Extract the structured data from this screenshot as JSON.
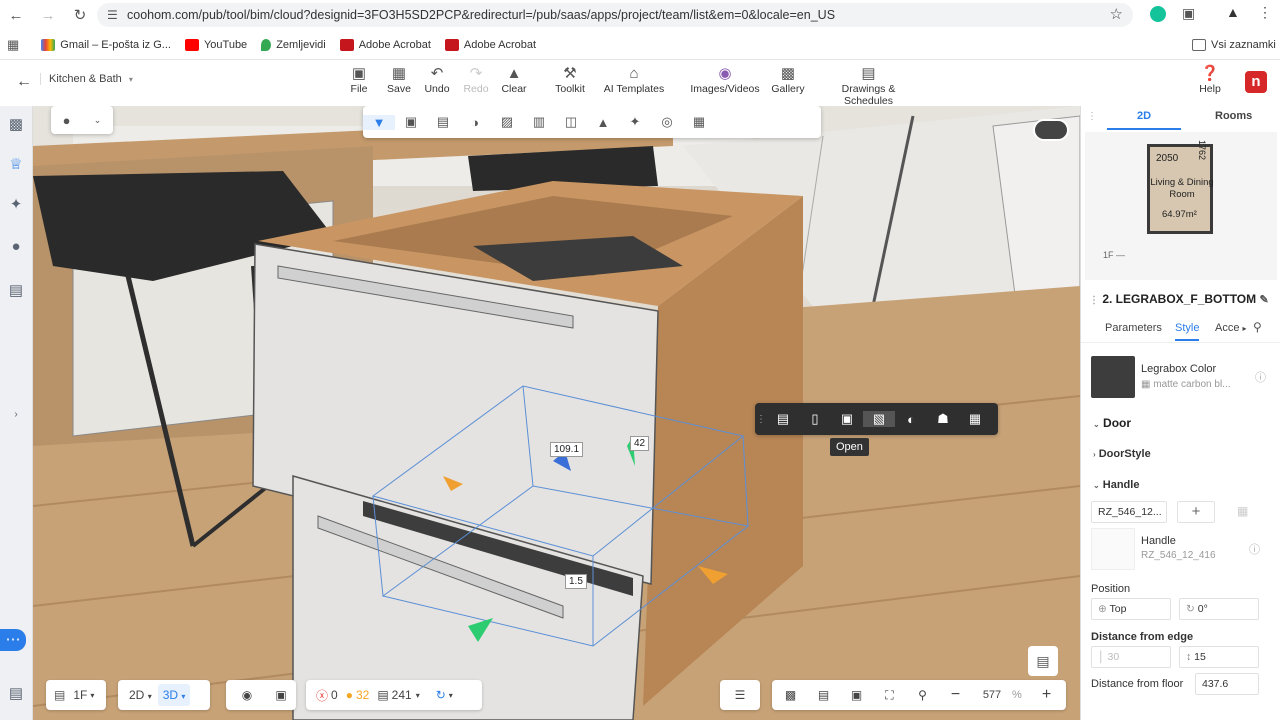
{
  "browser": {
    "url": "coohom.com/pub/tool/bim/cloud?designid=3FO3H5SD2PCP&redirecturl=/pub/saas/apps/project/team/list&em=0&locale=en_US",
    "bookmarks": [
      "Gmail – E-pošta iz G...",
      "YouTube",
      "Zemljevidi",
      "Adobe Acrobat",
      "Adobe Acrobat"
    ],
    "all_bookmarks": "Vsi zaznamki"
  },
  "header": {
    "project_name": "Kitchen & Bath",
    "tools": [
      "File",
      "Save",
      "Undo",
      "Redo",
      "Clear",
      "Toolkit",
      "AI Templates",
      "Images/Videos",
      "Gallery",
      "Drawings & Schedules",
      "Help"
    ],
    "logo_letter": "n"
  },
  "viewport": {
    "dim_width": "109.1",
    "dim_depth": "42",
    "dim_gap": "1.5",
    "tooltip": "Open"
  },
  "floorplan": {
    "tab_2d": "2D",
    "tab_rooms": "Rooms",
    "room_name": "Living & Dining Room",
    "room_area": "64.97m²",
    "dims": [
      "2050",
      "1762"
    ],
    "floor": "1F —"
  },
  "properties": {
    "title": "2. LEGRABOX_F_BOTTOM",
    "tabs": [
      "Parameters",
      "Style",
      "Acce"
    ],
    "color_label": "Legrabox Color",
    "color_value": "matte carbon bl...",
    "door_section": "Door",
    "door_style": "DoorStyle",
    "handle_section": "Handle",
    "handle_select": "RZ_546_12...",
    "handle_name": "Handle",
    "handle_code": "RZ_546_12_416",
    "position_label": "Position",
    "position_value": "Top",
    "angle_value": "0°",
    "distance_edge_label": "Distance from edge",
    "edge_value_1": "30",
    "edge_value_2": "15",
    "distance_floor_label": "Distance from floor",
    "floor_value": "437.6"
  },
  "bottom": {
    "floor_select": "1F",
    "view_2d": "2D",
    "view_3d": "3D",
    "errors": "0",
    "warnings": "32",
    "items": "241",
    "zoom_value": "577",
    "zoom_unit": "%"
  },
  "colors": {
    "accent": "#2b7de9",
    "brand_red": "#d62828"
  }
}
